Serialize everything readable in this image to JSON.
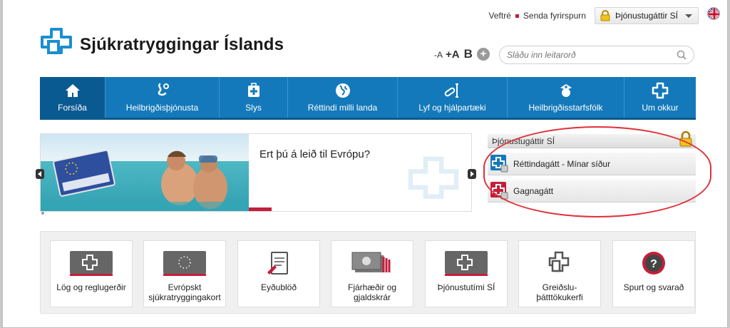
{
  "topbar": {
    "links": [
      "Veftré",
      "Senda fyrirspurn"
    ],
    "portal_dropdown": "Þjónustugáttir SÍ"
  },
  "logo": {
    "name": "Sjúkratryggingar Íslands"
  },
  "textsize": {
    "small": "-A",
    "medium": "+A",
    "bold": "B",
    "plus": "+"
  },
  "search": {
    "placeholder": "Sláðu inn leitarorð"
  },
  "nav": {
    "items": [
      {
        "label": "Forsíða",
        "icon": "home-icon"
      },
      {
        "label": "Heilbrigðisþjónusta",
        "icon": "stethoscope-icon"
      },
      {
        "label": "Slys",
        "icon": "first-aid-kit-icon"
      },
      {
        "label": "Réttindi milli landa",
        "icon": "globe-icon"
      },
      {
        "label": "Lyf og hjálpartæki",
        "icon": "pills-icon"
      },
      {
        "label": "Heilbrigðisstarfsfólk",
        "icon": "nurse-icon"
      },
      {
        "label": "Um okkur",
        "icon": "si-logo-icon"
      }
    ]
  },
  "slider": {
    "title": "Ert þú á leið til Evrópu?"
  },
  "portal": {
    "heading": "Þjónustugáttir SÍ",
    "links": [
      {
        "label": "Réttindagátt - Mínar síður",
        "color": "#1479ba"
      },
      {
        "label": "Gagnagátt",
        "color": "#c41e3a"
      }
    ]
  },
  "quicklinks": {
    "items": [
      {
        "label": "Lög og reglugerðir",
        "icon": "law-icon"
      },
      {
        "label": "Evrópskt sjúkratryggingakort",
        "icon": "eu-card-icon"
      },
      {
        "label": "Eyðublöð",
        "icon": "form-icon"
      },
      {
        "label": "Fjárhæðir og gjaldskrár",
        "icon": "money-icon"
      },
      {
        "label": "Þjónustutími SÍ",
        "icon": "clock-icon"
      },
      {
        "label": "Greiðslu-þátttökukerfi",
        "icon": "payment-system-icon"
      },
      {
        "label": "Spurt og svarað",
        "icon": "question-icon"
      }
    ]
  },
  "colors": {
    "brand_blue": "#1479ba",
    "brand_red": "#c41e3a",
    "annotation_red": "#e0303a"
  }
}
